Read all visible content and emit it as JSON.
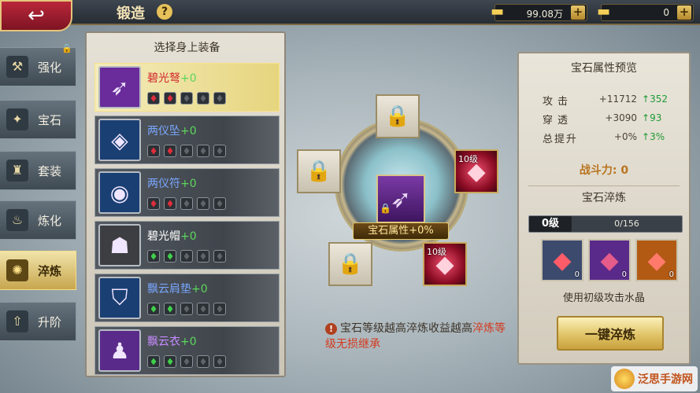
{
  "header": {
    "title": "锻造",
    "help_label": "?",
    "back_label": "↩",
    "currencies": [
      {
        "icon": "gold-ingot-icon",
        "value": "99.08万",
        "plus": "+"
      },
      {
        "icon": "locked-gold-icon",
        "value": "0",
        "plus": "+"
      }
    ]
  },
  "sidebar": {
    "items": [
      {
        "label": "强化",
        "icon": "hammer-icon",
        "active": false,
        "locked": true
      },
      {
        "label": "宝石",
        "icon": "gem-star-icon",
        "active": false,
        "locked": false
      },
      {
        "label": "套装",
        "icon": "armor-set-icon",
        "active": false,
        "locked": false
      },
      {
        "label": "炼化",
        "icon": "furnace-icon",
        "active": false,
        "locked": false
      },
      {
        "label": "淬炼",
        "icon": "swirl-icon",
        "active": true,
        "locked": false
      },
      {
        "label": "升阶",
        "icon": "arrow-up-icon",
        "active": false,
        "locked": false
      }
    ]
  },
  "equip_panel": {
    "title": "选择身上装备",
    "items": [
      {
        "name": "碧光弩",
        "plus": "+0",
        "gem_color": "red",
        "gem_count": 2,
        "icon": "crossbow-icon",
        "icon_bg": "#6a2c9a",
        "name_color": "#d1282e"
      },
      {
        "name": "两仪坠",
        "plus": "+0",
        "gem_color": "red",
        "gem_count": 2,
        "icon": "pendant-icon",
        "icon_bg": "#1a3f73",
        "name_color": "#79a6ff"
      },
      {
        "name": "两仪符",
        "plus": "+0",
        "gem_color": "red",
        "gem_count": 2,
        "icon": "jade-charm-icon",
        "icon_bg": "#1a3f73",
        "name_color": "#79a6ff"
      },
      {
        "name": "碧光帽",
        "plus": "+0",
        "gem_color": "green",
        "gem_count": 2,
        "icon": "helmet-icon",
        "icon_bg": "#3d3e42",
        "name_color": "#ffffff"
      },
      {
        "name": "飘云肩垫",
        "plus": "+0",
        "gem_color": "green",
        "gem_count": 2,
        "icon": "shoulder-pad-icon",
        "icon_bg": "#1a3f73",
        "name_color": "#79a6ff"
      },
      {
        "name": "飘云衣",
        "plus": "+0",
        "gem_color": "green",
        "gem_count": 2,
        "icon": "robe-icon",
        "icon_bg": "#5a2a8a",
        "name_color": "#c88bff"
      }
    ]
  },
  "center": {
    "label": "宝石属性+0%",
    "gem_slot_level": "10级"
  },
  "tip": {
    "part1": "宝石等级越高淬炼收益越高",
    "highlight": "淬炼等级无损继承"
  },
  "preview": {
    "title": "宝石属性预览",
    "stats": [
      {
        "name": "攻击",
        "value": "+11712",
        "up": "352"
      },
      {
        "name": "穿透",
        "value": "+3090",
        "up": "93"
      },
      {
        "name": "总提升",
        "value": "+0%",
        "up": "3%"
      }
    ],
    "power": "战斗力: 0"
  },
  "refine": {
    "title": "宝石淬炼",
    "level": "0级",
    "progress": "0/156",
    "crystals": [
      {
        "count": "0",
        "bg": "#3c4a6e",
        "color": "#ff5c6a"
      },
      {
        "count": "0",
        "bg": "#5a2a8a",
        "color": "#e55b8a"
      },
      {
        "count": "0",
        "bg": "#b25a14",
        "color": "#ff7a6a"
      }
    ],
    "caption": "使用初级攻击水晶",
    "button_label": "一键淬炼"
  },
  "watermark": {
    "text": "泛思手游网"
  }
}
